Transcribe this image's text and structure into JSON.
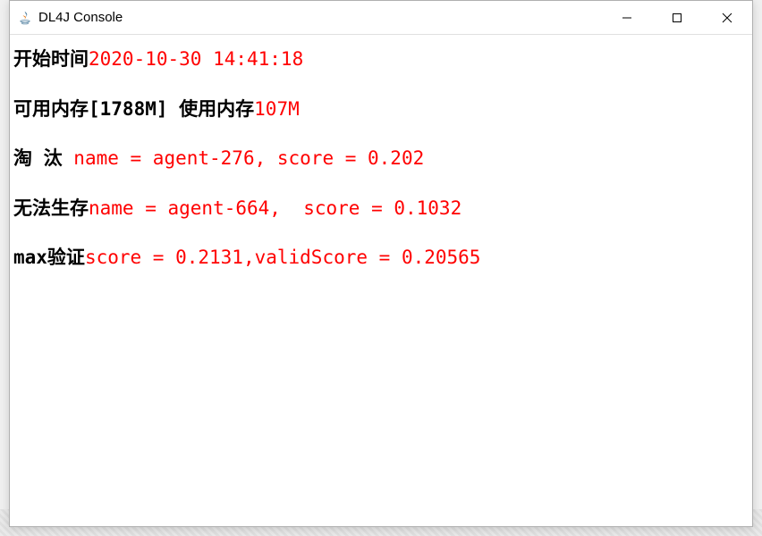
{
  "window": {
    "title": "DL4J Console"
  },
  "lines": {
    "l1_label": "开始时间",
    "l1_value": "2020-10-30 14:41:18",
    "l2_label": "可用内存[1788M] 使用内存",
    "l2_value": "107M",
    "l3_label": "淘 汰 ",
    "l3_value": "name = agent-276, score = 0.202",
    "l4_label": "无法生存",
    "l4_value": "name = agent-664,  score = 0.1032",
    "l5_label": "max验证",
    "l5_value": "score = 0.2131,validScore = 0.20565"
  }
}
